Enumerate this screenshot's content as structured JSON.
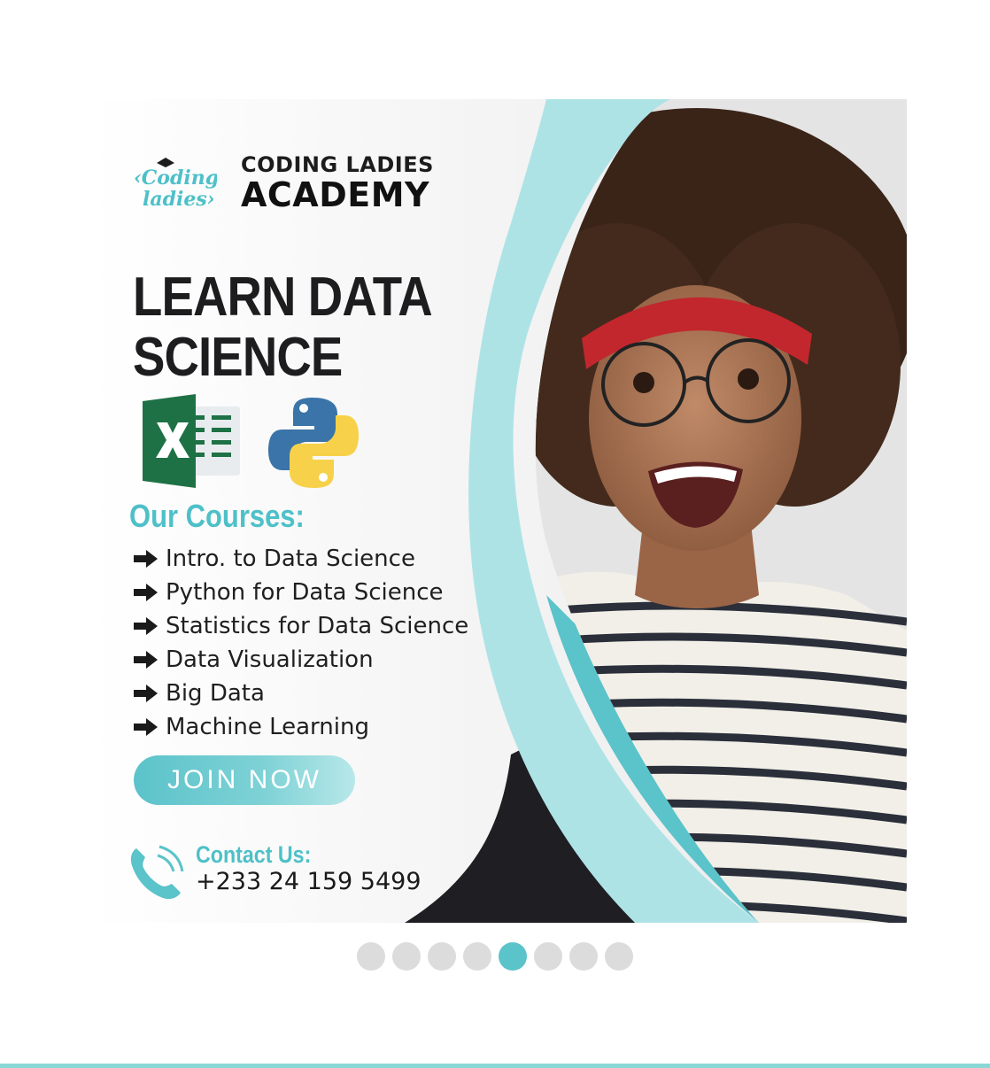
{
  "brand": {
    "name_line1": "CODING LADIES",
    "name_line2": "ACADEMY",
    "logo_text_top": "‹Coding",
    "logo_text_bottom": "ladies›"
  },
  "headline": {
    "line1": "LEARN DATA",
    "line2": "SCIENCE"
  },
  "tool_icons": [
    "excel-icon",
    "python-icon"
  ],
  "courses": {
    "title": "Our Courses:",
    "items": [
      "Intro. to Data Science",
      "Python for Data Science",
      "Statistics for Data Science",
      "Data Visualization",
      "Big Data",
      "Machine Learning"
    ]
  },
  "cta": {
    "label": "JOIN NOW"
  },
  "contact": {
    "label": "Contact Us:",
    "phone": "+233 24 159 5499"
  },
  "carousel": {
    "total": 8,
    "active_index": 4
  },
  "colors": {
    "accent": "#4ec0c8",
    "dark": "#1e1e23",
    "light_teal": "#aee3e6"
  }
}
